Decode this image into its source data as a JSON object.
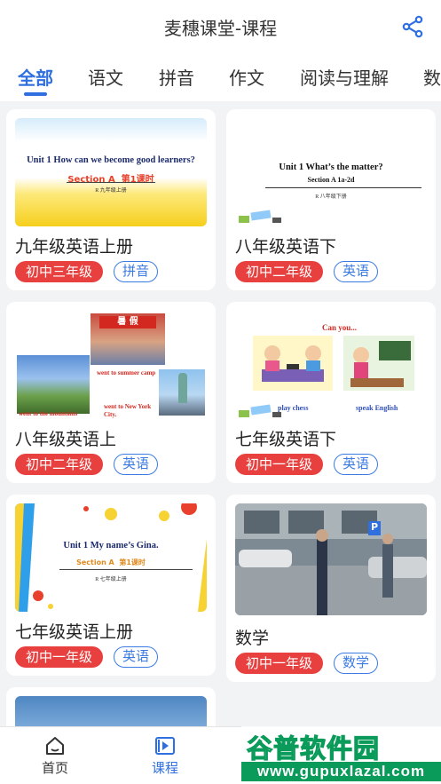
{
  "header": {
    "title": "麦穗课堂-课程",
    "share_icon": "share-icon"
  },
  "tabs": [
    {
      "label": "全部",
      "active": true
    },
    {
      "label": "语文"
    },
    {
      "label": "拼音"
    },
    {
      "label": "作文"
    },
    {
      "label": "阅读与理解"
    },
    {
      "label": "数"
    }
  ],
  "courses": [
    {
      "title": "九年级英语上册",
      "grade": "初中三年级",
      "subject": "拼音",
      "thumb": {
        "heading": "Unit 1  How can we become good learners?",
        "section": "Section A",
        "lesson": "第1课时",
        "tag": "R 九年级上册"
      }
    },
    {
      "title": "八年级英语下",
      "grade": "初中二年级",
      "subject": "英语",
      "thumb": {
        "heading": "Unit 1   What’s the matter?",
        "section": "Section A  1a-2d",
        "tag": "R 八年级下册"
      }
    },
    {
      "title": "八年级英语上",
      "grade": "初中二年级",
      "subject": "英语",
      "thumb": {
        "banner": "暑 假",
        "caption1": "went to summer camp",
        "caption2": "went to New York City.",
        "caption3": "went to the mountains"
      }
    },
    {
      "title": "七年级英语下",
      "grade": "初中一年级",
      "subject": "英语",
      "thumb": {
        "heading": "Can you...",
        "caption1": "play chess",
        "caption2": "speak English"
      }
    },
    {
      "title": "七年级英语上册",
      "grade": "初中一年级",
      "subject": "英语",
      "thumb": {
        "heading": "Unit 1  My name’s Gina.",
        "section": "Section A",
        "lesson": "第1课时",
        "tag": "R 七年级上册"
      }
    },
    {
      "title": "数学",
      "grade": "初中一年级",
      "subject": "数学",
      "thumb": {
        "sign": "P"
      }
    }
  ],
  "bottom_nav": [
    {
      "label": "首页",
      "icon": "home-icon",
      "active": false
    },
    {
      "label": "课程",
      "icon": "course-icon",
      "active": true
    }
  ],
  "watermark": {
    "title": "谷普软件园",
    "url": "www.gupuxlazal.com"
  },
  "colors": {
    "accent": "#2f6fe0",
    "grade_badge": "#e8403f",
    "subject_badge": "#3b7be3",
    "watermark": "#0a9b5a"
  }
}
